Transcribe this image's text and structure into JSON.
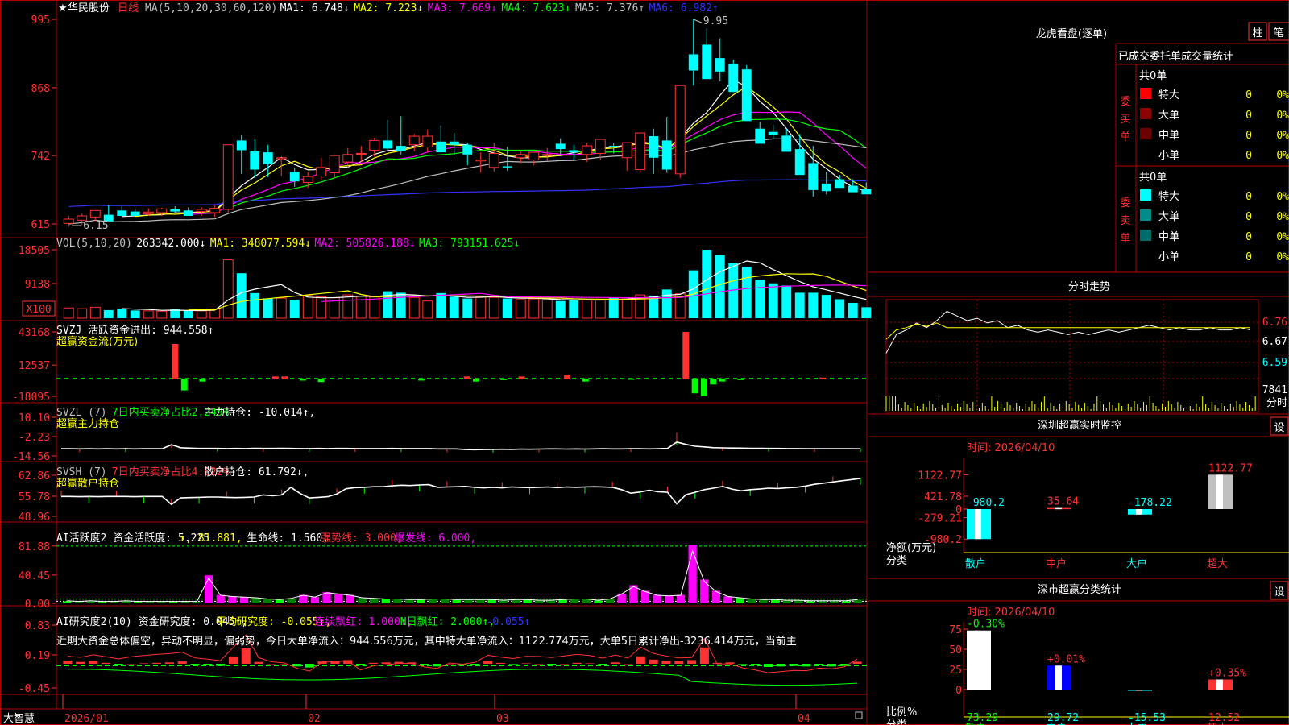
{
  "stock": {
    "star": "★",
    "name": "华民股份",
    "period": "日线"
  },
  "colors": {
    "up": "#ff3232",
    "down": "#00ffff",
    "frame": "#b00000",
    "ma1": "#ffffff",
    "ma2": "#ffff00",
    "ma3": "#ff00ff",
    "ma4": "#00ff00",
    "ma5": "#c0c0c0",
    "ma6": "#3333ff",
    "label": "#c0c0c0",
    "green": "#00ff00",
    "yellow": "#ffff00"
  },
  "main": {
    "header": [
      {
        "t": "MA(5,10,20,30,60,120)",
        "c": "#c0c0c0"
      },
      {
        "t": "MA1: 6.748↓",
        "c": "#ffffff"
      },
      {
        "t": "MA2: 7.223↓",
        "c": "#ffff00"
      },
      {
        "t": "MA3: 7.669↓",
        "c": "#ff00ff"
      },
      {
        "t": "MA4: 7.623↓",
        "c": "#00ff00"
      },
      {
        "t": "MA5: 7.376↑",
        "c": "#c0c0c0"
      },
      {
        "t": "MA6: 6.982↑",
        "c": "#3333ff"
      }
    ],
    "yticks": [
      "995",
      "868",
      "742",
      "615"
    ],
    "hi_label": "9.95",
    "lo_label": "6.15"
  },
  "vol": {
    "header": [
      {
        "t": "VOL(5,10,20)",
        "c": "#c0c0c0"
      },
      {
        "t": "263342.000↓",
        "c": "#ffffff"
      },
      {
        "t": "MA1: 348077.594↓",
        "c": "#ffff00"
      },
      {
        "t": "MA2: 505826.188↓",
        "c": "#ff00ff"
      },
      {
        "t": "MA3: 793151.625↓",
        "c": "#00ff00"
      }
    ],
    "yticks": [
      "18505",
      "9138",
      "X100"
    ]
  },
  "svzj": {
    "header": [
      {
        "t": "SVZJ  活跃资金进出: 944.558↑",
        "c": "#ffffff"
      }
    ],
    "sub": "超赢资金流(万元)",
    "yticks": [
      "43168",
      "12537",
      "-18095"
    ]
  },
  "svzl": {
    "header": [
      {
        "t": "SVZL (7)",
        "c": "#c0c0c0"
      },
      {
        "t": "7日内买卖净占比2.249%",
        "c": "#00ff00"
      },
      {
        "t": "主力持仓: -10.014↑,",
        "c": "#ffffff"
      }
    ],
    "sub": "超赢主力持仓",
    "yticks": [
      "10.10",
      "-2.23",
      "-14.56"
    ]
  },
  "svsh": {
    "header": [
      {
        "t": "SVSH (7)",
        "c": "#c0c0c0"
      },
      {
        "t": "7日内买卖净占比4.022%",
        "c": "#ff3232"
      },
      {
        "t": "散户持仓: 61.792↓,",
        "c": "#ffffff"
      }
    ],
    "sub": "超赢散户持仓",
    "yticks": [
      "62.86",
      "55.78",
      "48.96"
    ]
  },
  "ai1": {
    "header": [
      {
        "t": "AI活跃度2 资金活跃度: 5.225",
        "c": "#ffffff"
      },
      {
        "t": "↑, 81.881,",
        "c": "#ffff00"
      },
      {
        "t": "生命线: 1.560,",
        "c": "#ffffff"
      },
      {
        "t": "强势线: 3.000,",
        "c": "#ff3232"
      },
      {
        "t": "爆发线: 6.000,",
        "c": "#ff00ff"
      }
    ],
    "yticks": [
      "81.88",
      "40.45",
      "0.00"
    ]
  },
  "ai2": {
    "header": [
      {
        "t": "AI研究度2(10) 资金研究度: 0.045↑,",
        "c": "#ffffff"
      },
      {
        "t": "平均研究度: -0.055↑,",
        "c": "#ffff00"
      },
      {
        "t": "连续飘红: 1.000↑,",
        "c": "#ff00ff"
      },
      {
        "t": "N日飘红: 2.000↑,",
        "c": "#00ff00"
      },
      {
        "t": "-0.055↑",
        "c": "#3333ff"
      }
    ],
    "text": "近期大资金总体偏空，异动不明显，偏弱势，今日大单净流入：944.556万元，其中特大单净流入：1122.774万元，大单5日累计净出-3236.414万元，当前主",
    "yticks": [
      "0.83",
      "0.19",
      "-0.45"
    ]
  },
  "xaxis": [
    "2026/01",
    "02",
    "03",
    "04"
  ],
  "footer_left": "大智慧",
  "right": {
    "title": "龙虎看盘(逐单)",
    "tabs": [
      "柱",
      "笔"
    ],
    "subtitle": "已成交委托单成交量统计",
    "buy": {
      "label": "委买单",
      "total": "共0单",
      "rows": [
        [
          "特大",
          "0",
          "0%"
        ],
        [
          "大单",
          "0",
          "0%"
        ],
        [
          "中单",
          "0",
          "0%"
        ],
        [
          "小单",
          "0",
          "0%"
        ]
      ]
    },
    "sell": {
      "label": "委卖单",
      "total": "共0单",
      "rows": [
        [
          "特大",
          "0",
          "0%"
        ],
        [
          "大单",
          "0",
          "0%"
        ],
        [
          "中单",
          "0",
          "0%"
        ],
        [
          "小单",
          "0",
          "0%"
        ]
      ]
    },
    "intraday": {
      "title": "分时走势",
      "prices": [
        "6.76",
        "6.67",
        "6.59"
      ],
      "vol": "7841",
      "vol_unit": "分时"
    },
    "monitor": {
      "title": "深圳超赢实时监控",
      "btn": "设",
      "time": "时间: 2026/04/10",
      "yticks": [
        "1122.77",
        "421.78",
        "0",
        "-279.21",
        "-980.2"
      ],
      "ylabel1": "净额(万元)",
      "ylabel2": "分类",
      "cats": [
        "散户",
        "中户",
        "大户",
        "超大"
      ]
    },
    "classify": {
      "title": "深市超赢分类统计",
      "btn": "设",
      "time": "时间: 2026/04/10",
      "yticks": [
        "75",
        "50",
        "25",
        "0"
      ],
      "ylabel1": "比例%",
      "ylabel2": "分类",
      "cats": [
        "散户",
        "中户",
        "大户",
        "超大"
      ]
    }
  },
  "chart_data": [
    {
      "type": "candlestick",
      "name": "日线",
      "open": [
        6.16,
        6.22,
        6.28,
        6.32,
        6.4,
        6.38,
        6.34,
        6.36,
        6.42,
        6.4,
        6.38,
        6.36,
        6.42,
        7.7,
        7.5,
        7.48,
        7.36,
        7.12,
        6.92,
        7.04,
        7.1,
        7.3,
        7.45,
        7.52,
        7.7,
        7.6,
        7.62,
        7.58,
        7.68,
        7.68,
        7.62,
        7.32,
        7.2,
        7.22,
        7.38,
        7.34,
        7.42,
        7.64,
        7.52,
        7.44,
        7.46,
        7.6,
        7.38,
        7.16,
        7.78,
        7.7,
        7.08,
        9.3,
        9.48,
        9.23,
        9.12,
        9.02,
        7.92,
        7.86,
        7.79,
        7.54,
        7.28,
        6.9,
        6.98,
        6.86,
        6.8
      ],
      "high": [
        6.3,
        6.34,
        6.4,
        6.5,
        6.48,
        6.44,
        6.44,
        6.45,
        6.48,
        6.46,
        6.46,
        6.5,
        6.7,
        7.8,
        7.72,
        7.62,
        7.38,
        7.2,
        7.12,
        7.38,
        7.44,
        7.56,
        7.6,
        7.75,
        8.08,
        8.15,
        7.82,
        7.9,
        7.98,
        7.84,
        7.66,
        7.48,
        7.66,
        7.58,
        7.5,
        7.46,
        7.56,
        7.74,
        7.62,
        7.66,
        7.68,
        7.66,
        7.53,
        7.4,
        7.92,
        8.14,
        7.95,
        9.95,
        9.78,
        9.6,
        9.2,
        9.1,
        8.05,
        7.99,
        7.92,
        7.82,
        7.6,
        7.12,
        7.06,
        6.98,
        6.92
      ],
      "low": [
        6.1,
        6.14,
        6.2,
        6.24,
        6.32,
        6.3,
        6.3,
        6.3,
        6.34,
        6.32,
        6.3,
        6.28,
        6.34,
        7.08,
        7.0,
        7.02,
        7.04,
        6.84,
        6.82,
        6.96,
        7.0,
        7.2,
        7.3,
        7.4,
        7.52,
        7.44,
        7.5,
        7.48,
        7.56,
        7.42,
        7.24,
        7.1,
        7.12,
        7.14,
        7.28,
        7.24,
        7.32,
        7.44,
        7.34,
        7.3,
        7.34,
        7.46,
        7.14,
        7.1,
        7.08,
        7.1,
        7.0,
        8.72,
        9.0,
        8.8,
        8.6,
        8.1,
        7.78,
        7.72,
        7.5,
        7.3,
        6.66,
        6.7,
        6.82,
        6.74,
        6.7
      ],
      "close": [
        6.24,
        6.3,
        6.4,
        6.2,
        6.3,
        6.3,
        6.37,
        6.43,
        6.38,
        6.3,
        6.42,
        6.44,
        7.62,
        7.52,
        7.16,
        7.26,
        7.38,
        6.94,
        7.03,
        7.2,
        7.42,
        7.44,
        7.46,
        7.7,
        7.55,
        7.5,
        7.78,
        7.78,
        7.48,
        7.62,
        7.44,
        7.34,
        7.46,
        7.2,
        7.44,
        7.48,
        7.44,
        7.54,
        7.48,
        7.6,
        7.72,
        7.58,
        7.66,
        7.84,
        7.38,
        7.16,
        8.72,
        9.0,
        8.84,
        8.98,
        8.6,
        8.06,
        7.64,
        7.81,
        7.49,
        7.06,
        6.78,
        6.76,
        6.82,
        6.74,
        6.7
      ]
    },
    {
      "type": "bar",
      "name": "VOL",
      "values": [
        2400,
        2200,
        2600,
        1800,
        2100,
        1700,
        1600,
        1500,
        2000,
        1700,
        1600,
        2100,
        15700,
        12000,
        6500,
        5000,
        5100,
        4600,
        5800,
        5500,
        5200,
        6000,
        5700,
        5400,
        7000,
        6600,
        5300,
        4300,
        6500,
        5500,
        5000,
        5500,
        5300,
        5000,
        4700,
        4900,
        4600,
        4300,
        4600,
        4600,
        4700,
        5200,
        5200,
        6000,
        5800,
        7500,
        6300,
        12800,
        18500,
        17000,
        14800,
        13800,
        10200,
        9200,
        8600,
        6600,
        6600,
        6000,
        4800,
        3800,
        2600
      ]
    },
    {
      "type": "bar",
      "name": "超赢资金流(万元)",
      "values": [
        0,
        0,
        0,
        0,
        0,
        0,
        0,
        0,
        0,
        0,
        0,
        0,
        32000,
        -12000,
        0,
        -3000,
        0,
        0,
        0,
        0,
        0,
        0,
        0,
        2000,
        2000,
        0,
        -2000,
        0,
        -3500,
        0,
        0,
        0,
        0,
        0,
        0,
        0,
        0,
        0,
        0,
        -2000,
        0,
        0,
        0,
        0,
        2000,
        -3000,
        0,
        0,
        -1500,
        0,
        2000,
        0,
        0,
        0,
        0,
        3500,
        0,
        -3000,
        0,
        0,
        0,
        0,
        -1200,
        0,
        0,
        0,
        0,
        0,
        43168,
        -15000,
        -18000,
        -6000,
        -3000,
        0,
        -1500,
        0,
        0,
        0,
        0,
        0,
        0,
        0,
        0,
        944
      ]
    },
    {
      "type": "line",
      "name": "超赢主力持仓",
      "values": [
        -10.0,
        -10.0,
        -10.1,
        -10.0,
        -10.1,
        -10.0,
        -10.1,
        -10.0,
        -10.1,
        -10.0,
        -10.0,
        -10.0,
        -7.4,
        -9.3,
        -9.6,
        -9.8,
        -9.8,
        -9.8,
        -9.9,
        -9.8,
        -9.9,
        -9.7,
        -9.8,
        -9.8,
        -9.7,
        -9.8,
        -9.9,
        -9.9,
        -9.8,
        -9.9,
        -9.8,
        -9.8,
        -9.9,
        -9.9,
        -9.9,
        -9.9,
        -9.8,
        -9.9,
        -9.9,
        -9.9,
        -9.9,
        -10.1,
        -10.1,
        -10.1,
        -10.5,
        -10.6,
        -10.5,
        -10.4,
        -10.3,
        -10.4,
        -10.2,
        -10.3,
        -10.2,
        -10.1,
        -10.1,
        -10.2,
        -10.1,
        -10.2,
        -10.1,
        -10.0,
        -10.1,
        -10.1,
        -10.0,
        -10.0,
        -10.1,
        -10.0,
        -9.8,
        -5.7,
        -7.2,
        -8.4,
        -8.8,
        -9.3,
        -9.4,
        -9.5,
        -9.6,
        -9.7,
        -9.7,
        -9.8,
        -9.8,
        -9.9,
        -9.9,
        -10.0,
        -10.0,
        -10.0,
        -10.0,
        -10.0,
        -10.0,
        -10.014
      ]
    },
    {
      "type": "line",
      "name": "超赢散户持仓",
      "values": [
        55.7,
        55.7,
        55.6,
        55.7,
        55.6,
        55.7,
        55.7,
        55.7,
        55.6,
        55.7,
        55.7,
        55.7,
        53.0,
        55.2,
        55.3,
        55.4,
        55.5,
        55.5,
        55.4,
        55.3,
        55.4,
        55.5,
        56.2,
        55.9,
        56.2,
        58.8,
        56.7,
        55.2,
        55.4,
        55.6,
        56.5,
        58.3,
        58.7,
        58.8,
        59.0,
        59.0,
        59.3,
        59.5,
        59.4,
        59.6,
        59.7,
        58.8,
        58.9,
        59.0,
        59.1,
        58.8,
        58.6,
        58.8,
        58.6,
        58.9,
        58.8,
        58.7,
        58.8,
        58.9,
        58.7,
        58.9,
        58.8,
        58.9,
        59.0,
        58.9,
        58.8,
        58.0,
        56.8,
        57.2,
        57.8,
        57.3,
        57.1,
        53.2,
        56.3,
        57.1,
        58.0,
        58.5,
        59.1,
        58.2,
        57.6,
        58.0,
        58.2,
        58.5,
        58.4,
        58.6,
        58.8,
        59.2,
        59.8,
        60.2,
        60.6,
        61.0,
        61.4,
        61.792
      ]
    },
    {
      "type": "bar",
      "name": "AI活跃度2",
      "values": [
        3,
        2,
        3,
        2,
        2,
        3,
        2,
        2,
        2,
        2,
        2,
        2,
        40,
        12,
        10,
        9,
        8,
        6,
        5,
        7,
        12,
        9,
        16,
        14,
        12,
        8,
        7,
        6,
        6,
        5,
        5,
        6,
        6,
        5,
        5,
        5,
        5,
        4,
        5,
        5,
        4,
        4,
        5,
        6,
        6,
        4,
        6,
        14,
        26,
        18,
        12,
        11,
        12,
        84,
        34,
        18,
        10,
        8,
        6,
        5,
        5,
        4,
        4,
        3,
        3,
        3,
        3,
        5
      ]
    },
    {
      "type": "bar",
      "name": "AI研究度2(10)",
      "values": [
        0.07,
        0.04,
        0.06,
        0.02,
        -0.02,
        0.0,
        0.01,
        0.02,
        0.03,
        0.05,
        -0.02,
        -0.03,
        -0.04,
        0.15,
        0.33,
        0.04,
        0.0,
        0.0,
        -0.05,
        -0.07,
        0.05,
        0.06,
        0.08,
        -0.03,
        0.02,
        0.03,
        0.04,
        0.03,
        -0.02,
        -0.05,
        0.0,
        -0.03,
        -0.02,
        0.06,
        0.02,
        -0.01,
        0.01,
        0.0,
        -0.02,
        0.0,
        0.02,
        0.01,
        -0.02,
        0.03,
        0.0,
        0.16,
        0.09,
        0.07,
        0.06,
        0.08,
        0.35,
        0.02,
        0.03,
        -0.01,
        -0.03,
        -0.06,
        -0.05,
        -0.04,
        -0.05,
        -0.03,
        -0.05,
        -0.04,
        0.045
      ]
    },
    {
      "type": "line",
      "name": "分时走势",
      "values": [
        6.62,
        6.7,
        6.72,
        6.75,
        6.73,
        6.76,
        6.8,
        6.78,
        6.76,
        6.77,
        6.75,
        6.76,
        6.73,
        6.74,
        6.72,
        6.71,
        6.72,
        6.71,
        6.7,
        6.71,
        6.7,
        6.71,
        6.72,
        6.71,
        6.72,
        6.73,
        6.74,
        6.73,
        6.72,
        6.73,
        6.72,
        6.72,
        6.73,
        6.72,
        6.72,
        6.73,
        6.72
      ]
    },
    {
      "type": "bar",
      "name": "深圳超赢实时监控",
      "categories": [
        "散户",
        "中户",
        "大户",
        "超大"
      ],
      "values": [
        -980.2,
        35.64,
        -178.22,
        1122.77
      ]
    },
    {
      "type": "bar",
      "name": "深市超赢分类统计",
      "categories": [
        "散户",
        "中户",
        "大户",
        "超大"
      ],
      "values": [
        73.29,
        29.72,
        -15.53,
        12.52
      ],
      "change": [
        "-0.30%",
        "+0.01%",
        "",
        "+0.35%"
      ]
    }
  ]
}
